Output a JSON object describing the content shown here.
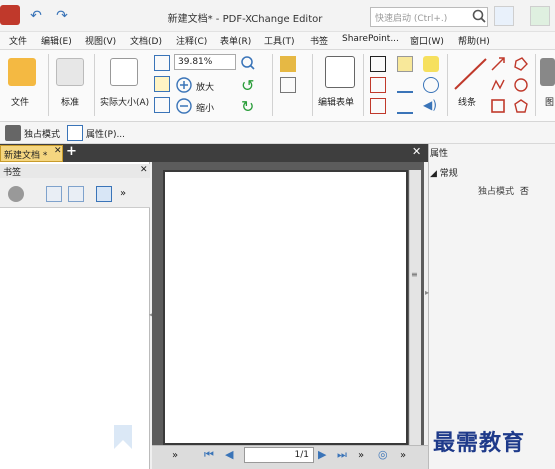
{
  "titlebar": {
    "title": "新建文档* - PDF-XChange Editor",
    "search_placeholder": "快速启动 (Ctrl+.)"
  },
  "menu": [
    "文件",
    "编辑(E)",
    "视图(V)",
    "文档(D)",
    "注释(C)",
    "表单(R)",
    "工具(T)",
    "书签",
    "SharePoint...",
    "窗口(W)",
    "帮助(H)"
  ],
  "ribbon": {
    "file_label": "文件",
    "standard_label": "标准",
    "actual_size_label": "实际大小(A)",
    "zoom_value": "39.81%",
    "zoom_in_label": "放大",
    "zoom_out_label": "缩小",
    "edit_form_label": "编辑表单",
    "lines_label": "线条",
    "image_label": "图"
  },
  "subbar": {
    "exclusive_mode_label": "独占模式",
    "properties_label": "属性(P)..."
  },
  "tabs": {
    "doc_tab_label": "新建文档 *",
    "add_tab_label": "+"
  },
  "bookmarks": {
    "title": "书签"
  },
  "navigation": {
    "page_value": "1/1"
  },
  "properties": {
    "title": "属性",
    "section": "常规",
    "rows": [
      {
        "name": "独占模式",
        "value": "否"
      }
    ]
  },
  "watermark": "最需教育",
  "colors": {
    "accent_blue": "#3a74b8",
    "tab_gold": "#f5d680",
    "canvas_gray": "#5c5c5c",
    "red_tool": "#c0392b"
  }
}
